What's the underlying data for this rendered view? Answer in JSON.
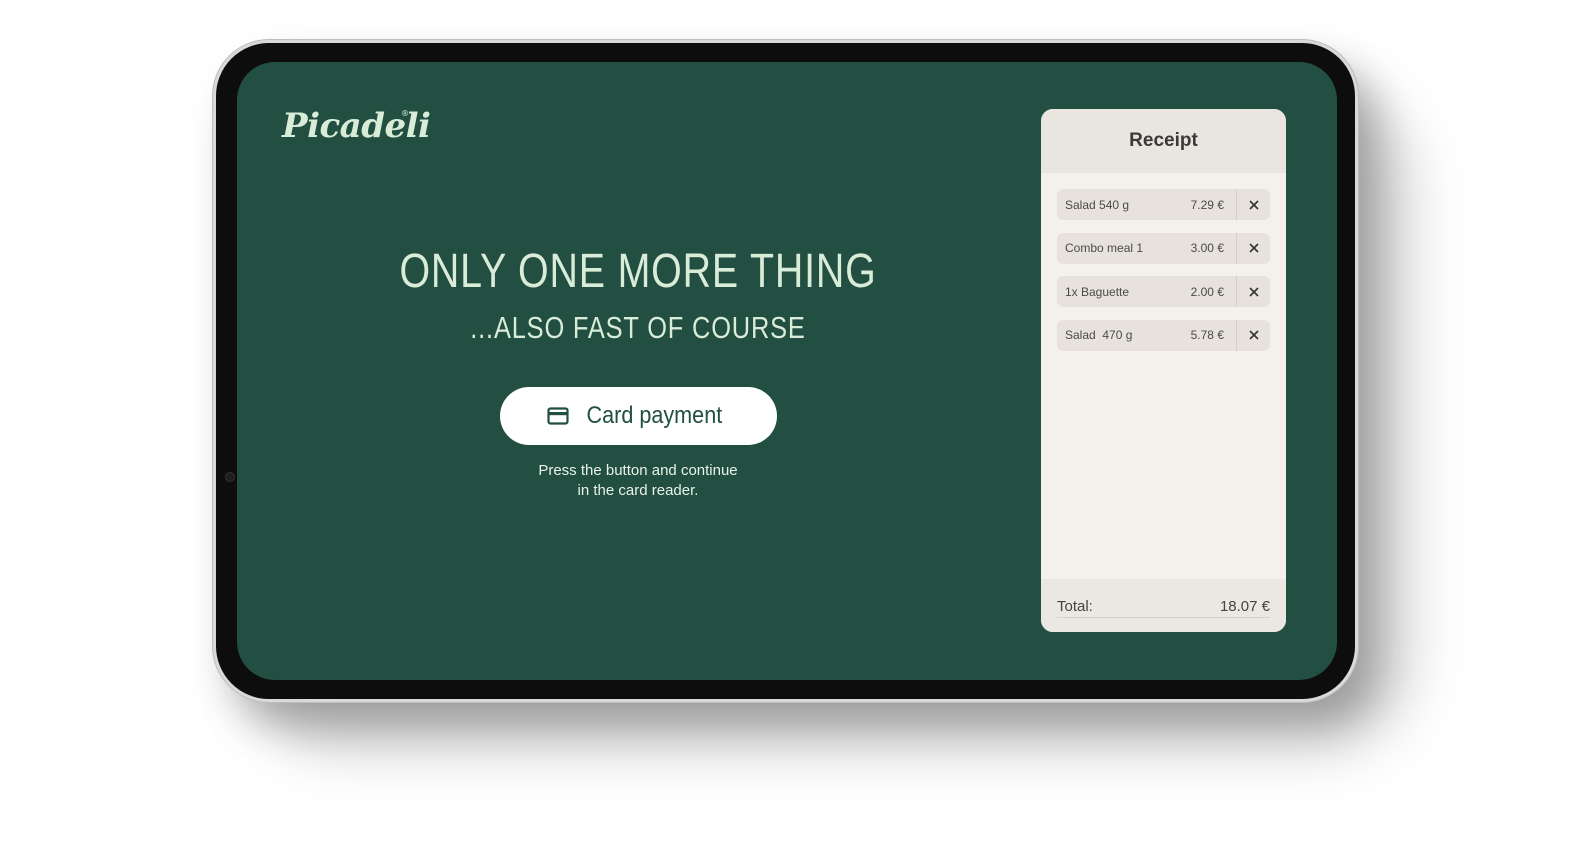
{
  "brand": {
    "logo_text": "Picadeli",
    "registered_mark": "®"
  },
  "main": {
    "headline": "ONLY ONE MORE THING",
    "subheadline": "...ALSO FAST OF COURSE",
    "pay_button_label": "Card payment",
    "pay_button_icon": "credit-card-icon",
    "hint_line1": "Press the button and continue",
    "hint_line2": "in the card reader."
  },
  "receipt": {
    "title": "Receipt",
    "items": [
      {
        "name": "Salad 540 g",
        "price": "7.29 €"
      },
      {
        "name": "Combo meal 1",
        "price": "3.00 €"
      },
      {
        "name": "1x Baguette",
        "price": "2.00 €"
      },
      {
        "name": "Salad  470 g",
        "price": "5.78 €"
      }
    ],
    "remove_icon": "close-icon",
    "total_label": "Total:",
    "total_value": "18.07 €"
  },
  "colors": {
    "screen_bg": "#224f42",
    "accent_text": "#d8ecd7",
    "receipt_bg": "#f4f1ec",
    "button_bg": "#ffffff"
  }
}
